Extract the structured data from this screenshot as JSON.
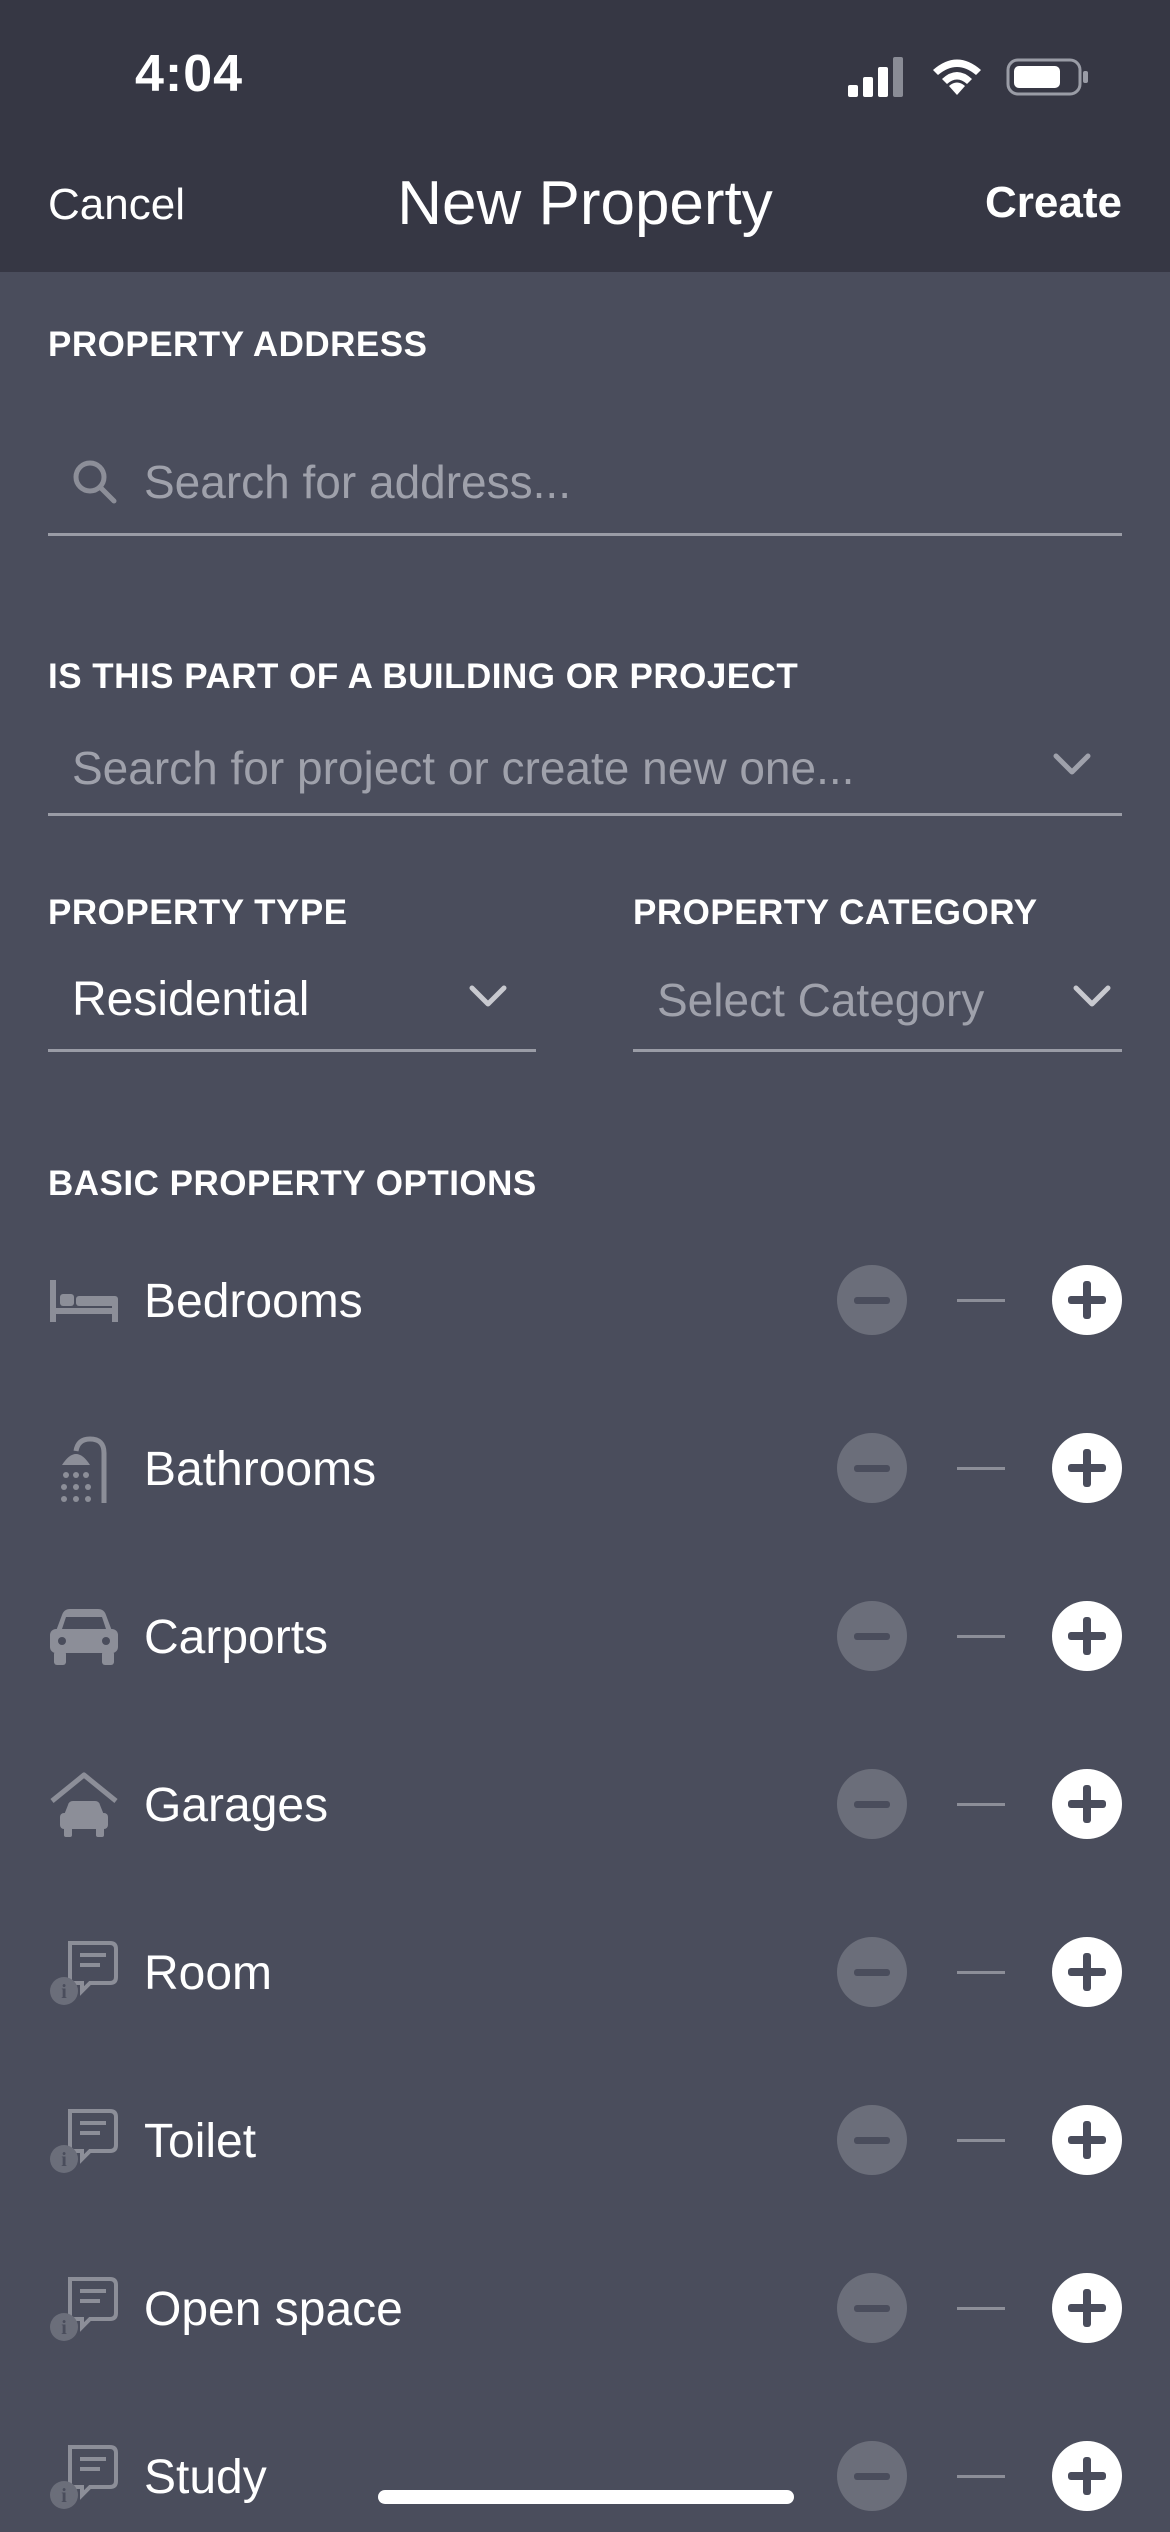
{
  "status_bar": {
    "time": "4:04"
  },
  "nav": {
    "cancel": "Cancel",
    "title": "New Property",
    "create": "Create"
  },
  "address": {
    "label": "PROPERTY ADDRESS",
    "placeholder": "Search for address..."
  },
  "project": {
    "label": "IS THIS PART OF A BUILDING OR PROJECT",
    "placeholder": "Search for project or create new one..."
  },
  "property_type": {
    "label": "PROPERTY TYPE",
    "value": "Residential"
  },
  "property_category": {
    "label": "PROPERTY CATEGORY",
    "placeholder": "Select Category"
  },
  "basic_options": {
    "label": "BASIC PROPERTY OPTIONS",
    "items": [
      {
        "label": "Bedrooms",
        "icon": "bed-icon",
        "value": "—"
      },
      {
        "label": "Bathrooms",
        "icon": "shower-icon",
        "value": "—"
      },
      {
        "label": "Carports",
        "icon": "car-icon",
        "value": "—"
      },
      {
        "label": "Garages",
        "icon": "garage-icon",
        "value": "—"
      },
      {
        "label": "Room",
        "icon": "room-info-icon",
        "value": "—"
      },
      {
        "label": "Toilet",
        "icon": "room-info-icon",
        "value": "—"
      },
      {
        "label": "Open space",
        "icon": "room-info-icon",
        "value": "—"
      },
      {
        "label": "Study",
        "icon": "room-info-icon",
        "value": "—"
      }
    ]
  },
  "colors": {
    "background": "#4a4d5c",
    "header": "#363744",
    "muted_text": "#9fa1ab",
    "stepper_minus": "#6b6e7a"
  }
}
